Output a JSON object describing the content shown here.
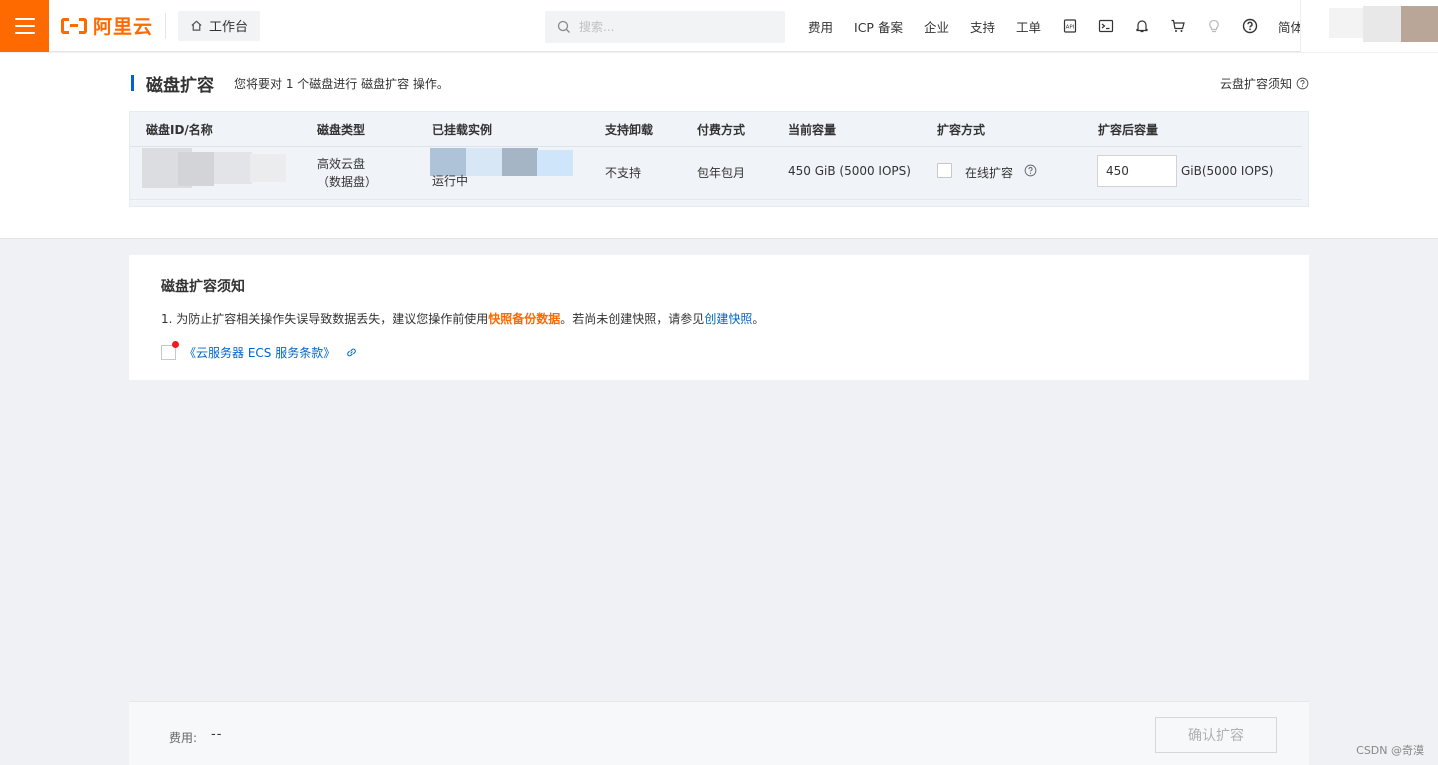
{
  "header": {
    "logo_text": "阿里云",
    "workbench_label": "工作台",
    "search_placeholder": "搜索...",
    "nav": [
      "费用",
      "ICP 备案",
      "企业",
      "支持",
      "工单"
    ],
    "lang_label": "简体",
    "icons": [
      "api-icon",
      "terminal-icon",
      "bell-icon",
      "cart-icon",
      "lightbulb-icon",
      "help-icon"
    ]
  },
  "page": {
    "title": "磁盘扩容",
    "description": "您将要对 1 个磁盘进行 磁盘扩容 操作。",
    "notice_link": "云盘扩容须知"
  },
  "table": {
    "headers": [
      "磁盘ID/名称",
      "磁盘类型",
      "已挂载实例",
      "支持卸载",
      "付费方式",
      "当前容量",
      "扩容方式",
      "扩容后容量"
    ],
    "row": {
      "disk_type_line1": "高效云盘",
      "disk_type_line2": "（数据盘）",
      "instance_status": "运行中",
      "detachable": "不支持",
      "billing": "包年包月",
      "current_capacity": "450 GiB (5000 IOPS)",
      "expand_method": "在线扩容",
      "new_capacity_value": "450",
      "new_capacity_unit": "GiB(5000 IOPS)"
    }
  },
  "notice": {
    "title": "磁盘扩容须知",
    "line_prefix": "1. 为防止扩容相关操作失误导致数据丢失，建议您操作前使用",
    "line_highlight": "快照备份数据",
    "line_middle": "。若尚未创建快照，请参见",
    "line_link": "创建快照",
    "line_suffix": "。",
    "agreement_link": "《云服务器 ECS 服务条款》"
  },
  "footer": {
    "fee_label": "费用:",
    "fee_value": "--",
    "confirm_label": "确认扩容"
  },
  "watermark": "CSDN @奇漠",
  "colors": {
    "brand": "#ff6a00",
    "link": "#0064c8",
    "required_dot": "#f21b1b"
  }
}
